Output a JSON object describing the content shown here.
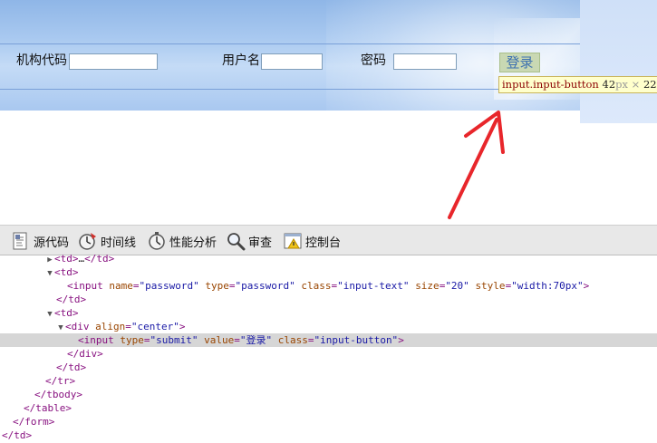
{
  "page_form": {
    "org_code_label": "机构代码",
    "username_label": "用户名",
    "password_label": "密码",
    "login_button": "登录"
  },
  "tooltip": {
    "tag": "input",
    "cls": ".input-button",
    "w": "42",
    "h": "22",
    "unit": "px",
    "times": "×"
  },
  "devtools": {
    "tabs": [
      {
        "label": "源代码",
        "icon": "source-code-icon"
      },
      {
        "label": "时间线",
        "icon": "timeline-icon"
      },
      {
        "label": "性能分析",
        "icon": "profiler-icon"
      },
      {
        "label": "审查",
        "icon": "audits-icon"
      },
      {
        "label": "控制台",
        "icon": "console-icon"
      }
    ],
    "lines": [
      {
        "twisty": "▶",
        "html": "<td>…</td>"
      },
      {
        "twisty": "▼",
        "html": "<td>"
      },
      {
        "twisty": "",
        "html": "<input name=\"password\" type=\"password\" class=\"input-text\" size=\"20\" style=\"width:70px\">"
      },
      {
        "twisty": "",
        "html": "</td>"
      },
      {
        "twisty": "▼",
        "html": "<td>"
      },
      {
        "twisty": "▼",
        "html": "<div align=\"center\">"
      },
      {
        "twisty": "",
        "html": "<input type=\"submit\" value=\"登录\" class=\"input-button\">"
      },
      {
        "twisty": "",
        "html": "</div>"
      },
      {
        "twisty": "",
        "html": "</td>"
      },
      {
        "twisty": "",
        "html": "</tr>"
      },
      {
        "twisty": "",
        "html": "</tbody>"
      },
      {
        "twisty": "",
        "html": "</table>"
      },
      {
        "twisty": "",
        "html": "</form>"
      },
      {
        "twisty": "",
        "html": "</td>"
      }
    ],
    "selected_line_index": 6
  },
  "colors": {
    "arrow": "#e8262b",
    "tag": "#881280",
    "attr_name": "#994500",
    "attr_value": "#1a1aa6",
    "selection": "#d6d6d6"
  }
}
